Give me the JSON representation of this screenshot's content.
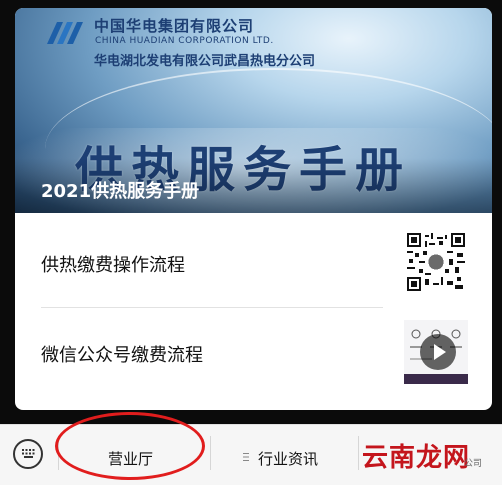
{
  "banner": {
    "company_cn": "中国华电集团有限公司",
    "company_en": "CHINA HUADIAN CORPORATION LTD.",
    "branch": "华电湖北发电有限公司武昌热电分公司",
    "big_title": "供热服务手册",
    "caption": "2021供热服务手册"
  },
  "items": [
    {
      "label": "供热缴费操作流程",
      "thumb": "qr-code"
    },
    {
      "label": "微信公众号缴费流程",
      "thumb": "video"
    }
  ],
  "bottom_bar": {
    "tabs": [
      {
        "label": "营业厅"
      },
      {
        "label": "行业资讯",
        "icon": "menu-icon"
      }
    ]
  },
  "watermark": {
    "text": "云南龙网",
    "small": "公司"
  },
  "colors": {
    "accent_red": "#e11d1d",
    "brand_blue": "#1d3f74"
  }
}
